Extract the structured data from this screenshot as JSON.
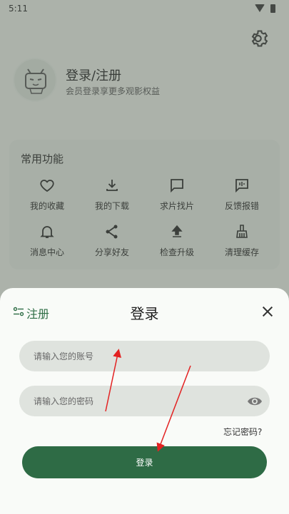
{
  "status_bar": {
    "time": "5:11"
  },
  "colors": {
    "accent": "#2e6b45",
    "arrow": "#e32222"
  },
  "profile": {
    "title": "登录/注册",
    "subtitle": "会员登录享更多观影权益"
  },
  "functions": {
    "title": "常用功能",
    "items": [
      {
        "label": "我的收藏",
        "icon": "heart-icon"
      },
      {
        "label": "我的下载",
        "icon": "download-icon"
      },
      {
        "label": "求片找片",
        "icon": "chat-icon"
      },
      {
        "label": "反馈报错",
        "icon": "feedback-icon"
      },
      {
        "label": "消息中心",
        "icon": "bell-icon"
      },
      {
        "label": "分享好友",
        "icon": "share-icon"
      },
      {
        "label": "检查升级",
        "icon": "upgrade-icon"
      },
      {
        "label": "清理缓存",
        "icon": "broom-icon"
      }
    ]
  },
  "login_sheet": {
    "register_label": "注册",
    "title": "登录",
    "account_placeholder": "请输入您的账号",
    "password_placeholder": "请输入您的密码",
    "forgot_password": "忘记密码?",
    "login_button": "登录"
  }
}
